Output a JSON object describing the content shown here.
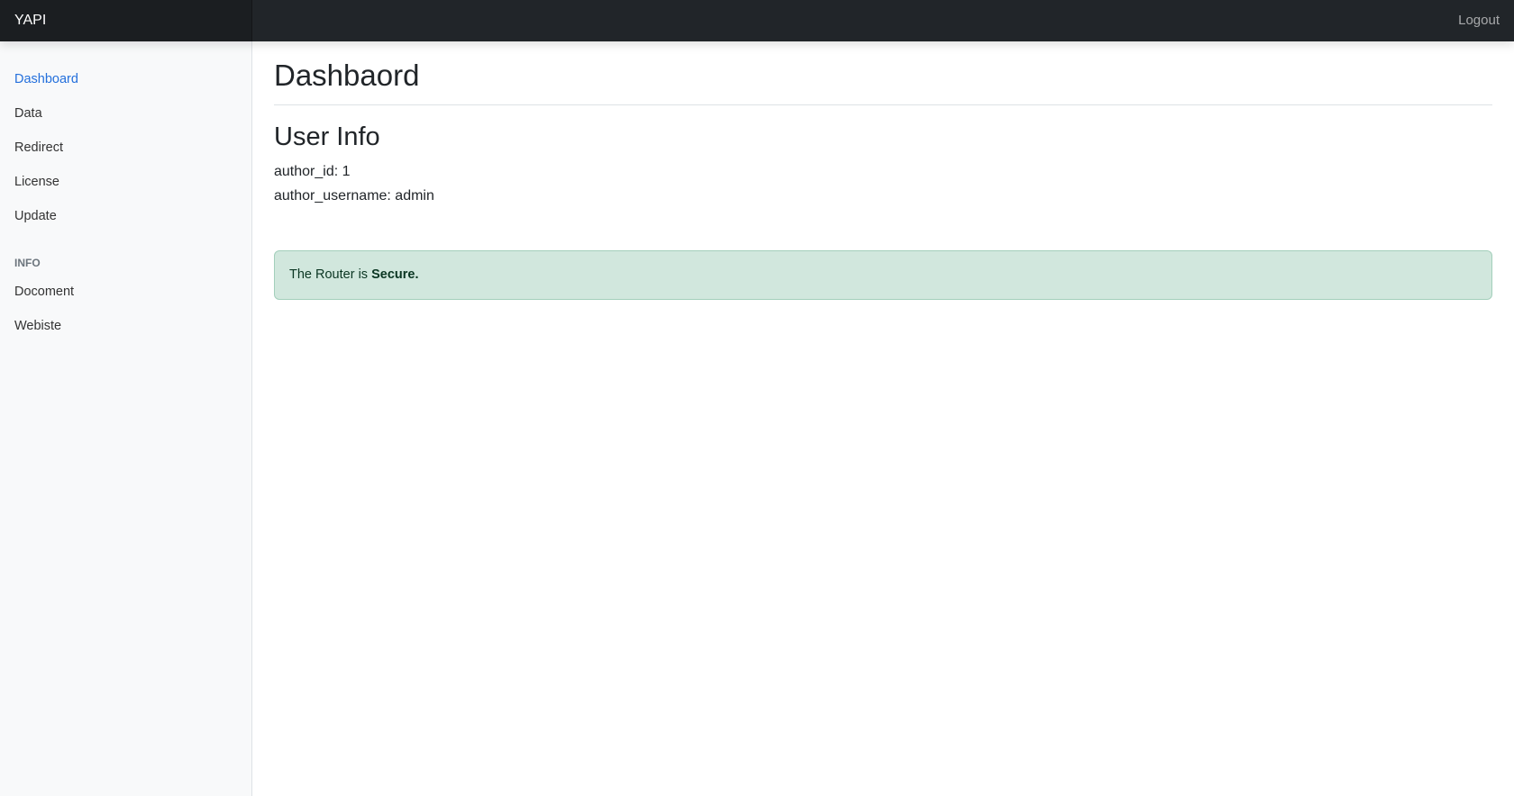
{
  "navbar": {
    "brand": "YAPI",
    "logout": "Logout"
  },
  "sidebar": {
    "items": [
      {
        "label": "Dashboard",
        "active": true
      },
      {
        "label": "Data"
      },
      {
        "label": "Redirect"
      },
      {
        "label": "License"
      },
      {
        "label": "Update"
      }
    ],
    "info_heading": "INFO",
    "info_items": [
      {
        "label": "Docoment"
      },
      {
        "label": "Webiste"
      }
    ]
  },
  "main": {
    "title": "Dashbaord",
    "section_title": "User Info",
    "author_id_line": "author_id: 1",
    "author_username_line": "author_username: admin",
    "alert": {
      "prefix": "The Router is ",
      "status": "Secure."
    }
  },
  "colors": {
    "navbar_bg": "#212529",
    "active_link": "#2470dc",
    "alert_bg": "#d1e7dd",
    "alert_text": "#0a3622"
  }
}
